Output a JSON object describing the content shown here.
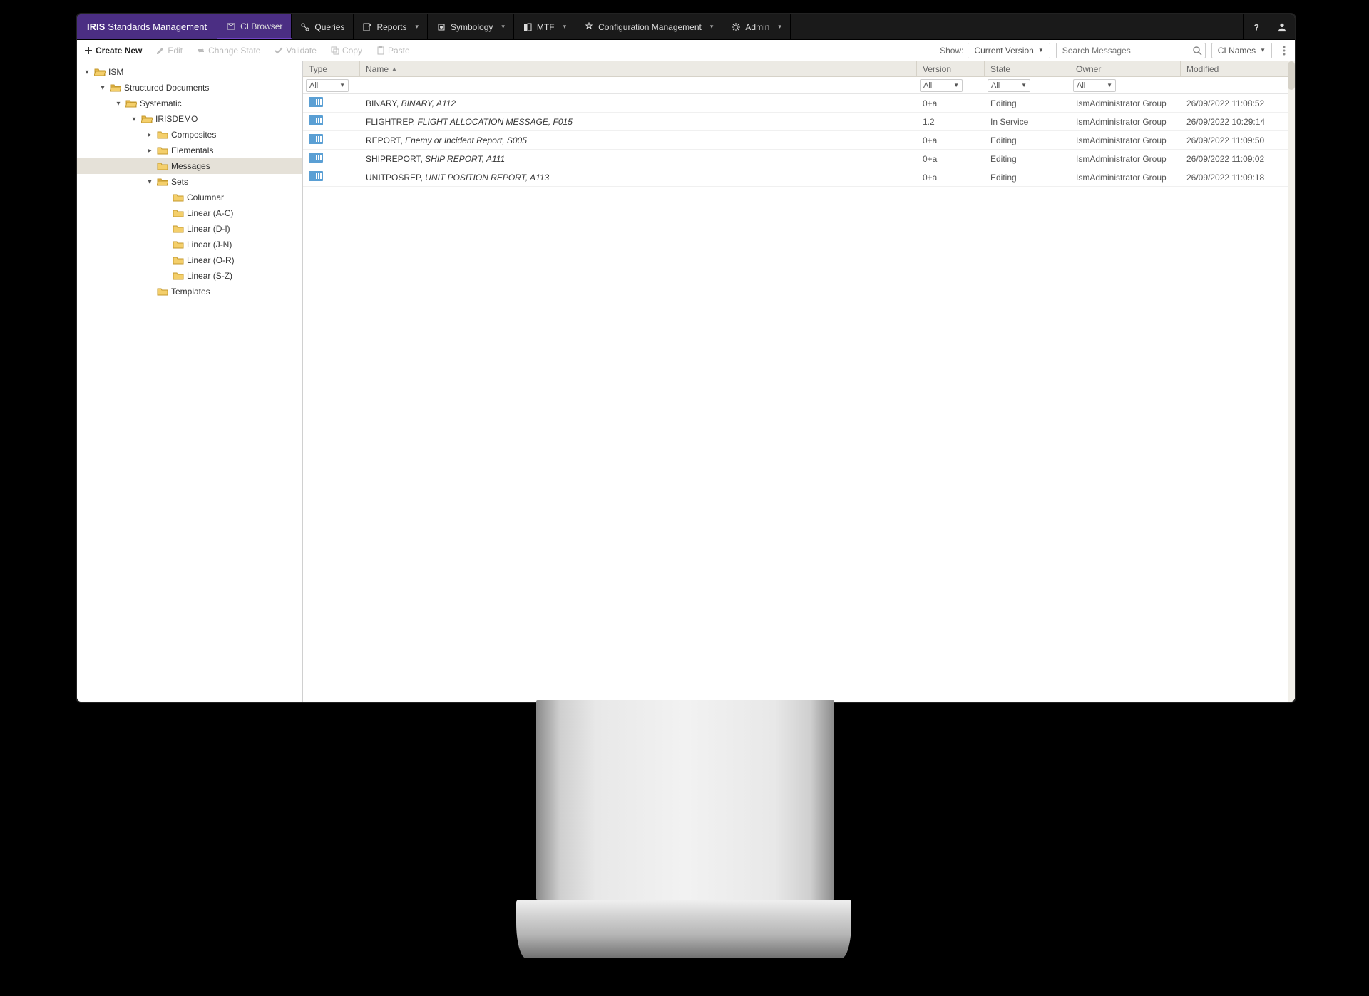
{
  "brand": {
    "bold": "IRIS",
    "rest": "Standards Management"
  },
  "nav": {
    "items": [
      {
        "label": "CI Browser",
        "active": true,
        "dropdown": false
      },
      {
        "label": "Queries",
        "active": false,
        "dropdown": false
      },
      {
        "label": "Reports",
        "active": false,
        "dropdown": true
      },
      {
        "label": "Symbology",
        "active": false,
        "dropdown": true
      },
      {
        "label": "MTF",
        "active": false,
        "dropdown": true
      },
      {
        "label": "Configuration Management",
        "active": false,
        "dropdown": true
      },
      {
        "label": "Admin",
        "active": false,
        "dropdown": true
      }
    ]
  },
  "toolbar": {
    "create_new": "Create New",
    "edit": "Edit",
    "change_state": "Change State",
    "validate": "Validate",
    "copy": "Copy",
    "paste": "Paste",
    "show_label": "Show:",
    "current_version": "Current Version",
    "search_placeholder": "Search Messages",
    "ci_names": "CI Names"
  },
  "tree": {
    "nodes": [
      {
        "depth": 0,
        "expanded": true,
        "open": true,
        "label": "ISM"
      },
      {
        "depth": 1,
        "expanded": true,
        "open": true,
        "label": "Structured Documents"
      },
      {
        "depth": 2,
        "expanded": true,
        "open": true,
        "label": "Systematic"
      },
      {
        "depth": 3,
        "expanded": true,
        "open": true,
        "label": "IRISDEMO"
      },
      {
        "depth": 4,
        "expanded": false,
        "open": false,
        "hasChildren": true,
        "label": "Composites"
      },
      {
        "depth": 4,
        "expanded": false,
        "open": false,
        "hasChildren": true,
        "label": "Elementals"
      },
      {
        "depth": 4,
        "expanded": null,
        "open": false,
        "label": "Messages",
        "selected": true
      },
      {
        "depth": 4,
        "expanded": true,
        "open": true,
        "label": "Sets"
      },
      {
        "depth": 5,
        "expanded": null,
        "open": false,
        "label": "Columnar"
      },
      {
        "depth": 5,
        "expanded": null,
        "open": false,
        "label": "Linear (A-C)"
      },
      {
        "depth": 5,
        "expanded": null,
        "open": false,
        "label": "Linear (D-I)"
      },
      {
        "depth": 5,
        "expanded": null,
        "open": false,
        "label": "Linear (J-N)"
      },
      {
        "depth": 5,
        "expanded": null,
        "open": false,
        "label": "Linear (O-R)"
      },
      {
        "depth": 5,
        "expanded": null,
        "open": false,
        "label": "Linear (S-Z)"
      },
      {
        "depth": 4,
        "expanded": null,
        "open": false,
        "label": "Templates"
      }
    ]
  },
  "grid": {
    "columns": {
      "type": "Type",
      "name": "Name",
      "version": "Version",
      "state": "State",
      "owner": "Owner",
      "modified": "Modified"
    },
    "filters": {
      "type": "All",
      "version": "All",
      "state": "All",
      "owner": "All"
    },
    "rows": [
      {
        "name_main": "BINARY,",
        "name_ital": " BINARY, A112",
        "version": "0+a",
        "state": "Editing",
        "owner": "IsmAdministrator Group",
        "modified": "26/09/2022 11:08:52"
      },
      {
        "name_main": "FLIGHTREP,",
        "name_ital": " FLIGHT ALLOCATION MESSAGE, F015",
        "version": "1.2",
        "state": "In Service",
        "owner": "IsmAdministrator Group",
        "modified": "26/09/2022 10:29:14"
      },
      {
        "name_main": "REPORT,",
        "name_ital": " Enemy or Incident Report, S005",
        "version": "0+a",
        "state": "Editing",
        "owner": "IsmAdministrator Group",
        "modified": "26/09/2022 11:09:50"
      },
      {
        "name_main": "SHIPREPORT,",
        "name_ital": " SHIP REPORT, A111",
        "version": "0+a",
        "state": "Editing",
        "owner": "IsmAdministrator Group",
        "modified": "26/09/2022 11:09:02"
      },
      {
        "name_main": "UNITPOSREP,",
        "name_ital": " UNIT POSITION REPORT, A113",
        "version": "0+a",
        "state": "Editing",
        "owner": "IsmAdministrator Group",
        "modified": "26/09/2022 11:09:18"
      }
    ]
  }
}
